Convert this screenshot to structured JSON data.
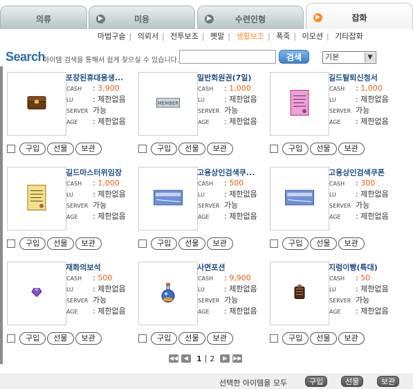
{
  "tabs": [
    {
      "label": "의류",
      "active": false
    },
    {
      "label": "미용",
      "active": false
    },
    {
      "label": "수련인형",
      "active": false
    },
    {
      "label": "잡화",
      "active": true
    }
  ],
  "subnav": [
    "마법구슬",
    "의뢰서",
    "전투보조",
    "펫말",
    "생활보조",
    "폭죽",
    "이모션",
    "기타잡화"
  ],
  "subnav_active": "생활보조",
  "search": {
    "title": "Search",
    "description": "아이템 검색을 통해서 쉽게 찾으실 수 있습니다.",
    "input_value": "",
    "button_label": "검색",
    "sort_value": "기본"
  },
  "meta_labels": {
    "cash": "CASH",
    "lv": "LU",
    "server": "SERVER",
    "age": "AGE"
  },
  "actions": {
    "buy": "구입",
    "gift": "선물",
    "keep": "보관"
  },
  "items": [
    {
      "name": "포장된휴대용생...",
      "cash": "3,900",
      "lv": "제한없음",
      "server": "가능",
      "age": "제한없음",
      "icon": "chest-icon"
    },
    {
      "name": "일반회원권(7일)",
      "cash": "1,000",
      "lv": "제한없음",
      "server": "가능",
      "age": "제한없음",
      "icon": "member-card-icon"
    },
    {
      "name": "길드탈퇴신청서",
      "cash": "1,000",
      "lv": "제한없음",
      "server": "가능",
      "age": "제한없음",
      "icon": "guild-leave-scroll-icon"
    },
    {
      "name": "길드마스터위임장",
      "cash": "1,000",
      "lv": "제한없음",
      "server": "가능",
      "age": "제한없음",
      "icon": "guild-master-scroll-icon"
    },
    {
      "name": "고용상인검색쿠...",
      "cash": "500",
      "lv": "제한없음",
      "server": "가능",
      "age": "제한없음",
      "icon": "search-coupon-icon"
    },
    {
      "name": "고용상인검색쿠폰",
      "cash": "300",
      "lv": "제한없음",
      "server": "가능",
      "age": "제한없음",
      "icon": "search-coupon-icon"
    },
    {
      "name": "재화의보석",
      "cash": "500",
      "lv": "제한없음",
      "server": "가능",
      "age": "제한없음",
      "icon": "purple-gem-icon"
    },
    {
      "name": "사면포션",
      "cash": "9,900",
      "lv": "제한없음",
      "server": "가능",
      "age": "제한없음",
      "icon": "potion-icon"
    },
    {
      "name": "지렁이빵(특대)",
      "cash": "50",
      "lv": "제한없음",
      "server": "가능",
      "age": "제한없음",
      "icon": "bread-icon"
    }
  ],
  "pager": {
    "current": "1",
    "separator": "|",
    "next": "2"
  },
  "footer": {
    "label": "선택한 아이템을 모두",
    "buy": "구입",
    "gift": "선물",
    "keep": "보관"
  }
}
